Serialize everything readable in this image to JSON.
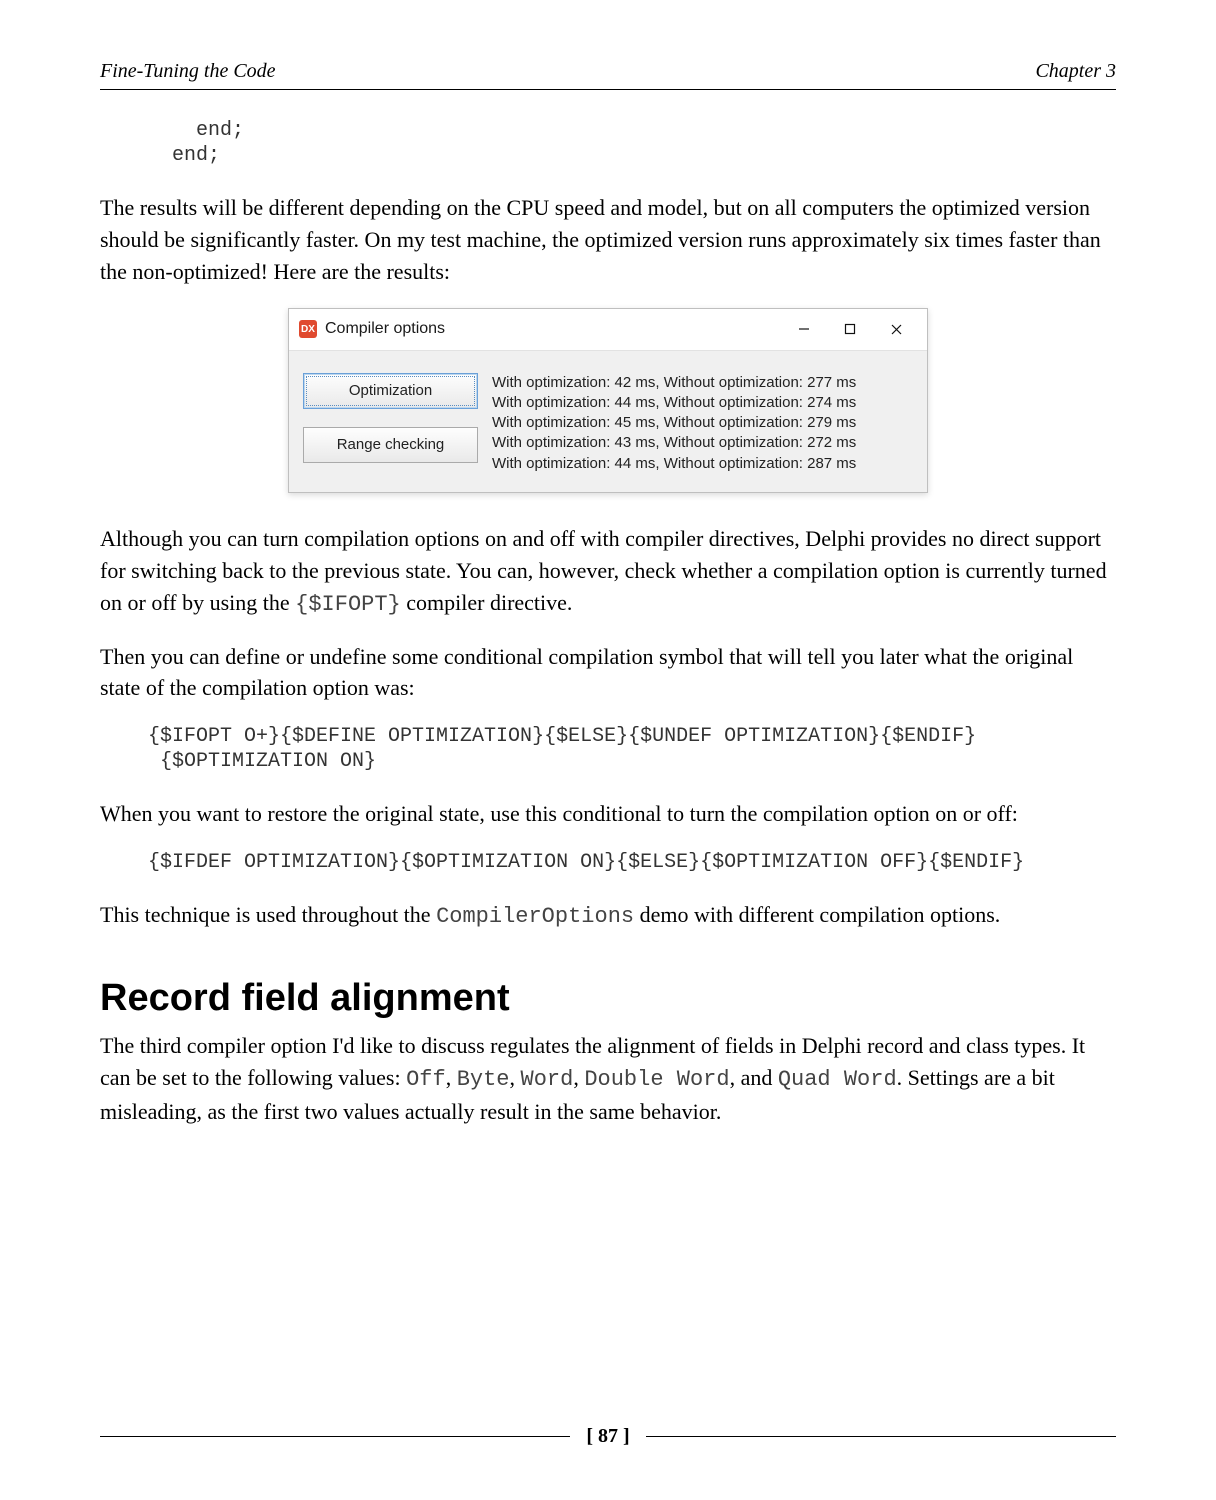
{
  "header": {
    "left": "Fine-Tuning the Code",
    "right": "Chapter 3"
  },
  "code1": "    end;\n  end;",
  "para1": "The results will be different depending on the CPU speed and model, but on all computers the optimized version should be significantly faster. On my test machine, the optimized version runs approximately six times faster than the non-optimized! Here are the results:",
  "window": {
    "icon_text": "DX",
    "title": "Compiler options",
    "buttons": {
      "optimization": "Optimization",
      "range_checking": "Range checking"
    },
    "results": [
      "With optimization: 42 ms, Without optimization: 277 ms",
      "With optimization: 44 ms, Without optimization: 274 ms",
      "With optimization: 45 ms, Without optimization: 279 ms",
      "With optimization: 43 ms, Without optimization: 272 ms",
      "With optimization: 44 ms, Without optimization: 287 ms"
    ]
  },
  "para2_pre": "Although you can turn compilation options on and off with compiler directives, Delphi provides no direct support for switching back to the previous state. You can, however, check whether a compilation option is currently turned on or off by using the ",
  "para2_code": "{$IFOPT}",
  "para2_post": " compiler directive.",
  "para3": "Then you can define or undefine some conditional compilation symbol that will tell you later what the original state of the compilation option was:",
  "code2": "{$IFOPT O+}{$DEFINE OPTIMIZATION}{$ELSE}{$UNDEF OPTIMIZATION}{$ENDIF}\n {$OPTIMIZATION ON}",
  "para4": "When you want to restore the original state, use this conditional to turn the compilation option on or off:",
  "code3": "{$IFDEF OPTIMIZATION}{$OPTIMIZATION ON}{$ELSE}{$OPTIMIZATION OFF}{$ENDIF}",
  "para5_pre": "This technique is used throughout the ",
  "para5_code": "CompilerOptions",
  "para5_post": " demo with different compilation options.",
  "section_heading": "Record field alignment",
  "para6": {
    "t1": "The third compiler option I'd like to discuss regulates the alignment of fields in Delphi record and class types. It can be set to the following values: ",
    "c1": "Off",
    "t2": ", ",
    "c2": "Byte",
    "t3": ", ",
    "c3": "Word",
    "t4": ", ",
    "c4": "Double Word",
    "t5": ", and ",
    "c5": "Quad Word",
    "t6": ". Settings are a bit misleading, as the first two values actually result in the same behavior."
  },
  "page_number": "[ 87 ]"
}
